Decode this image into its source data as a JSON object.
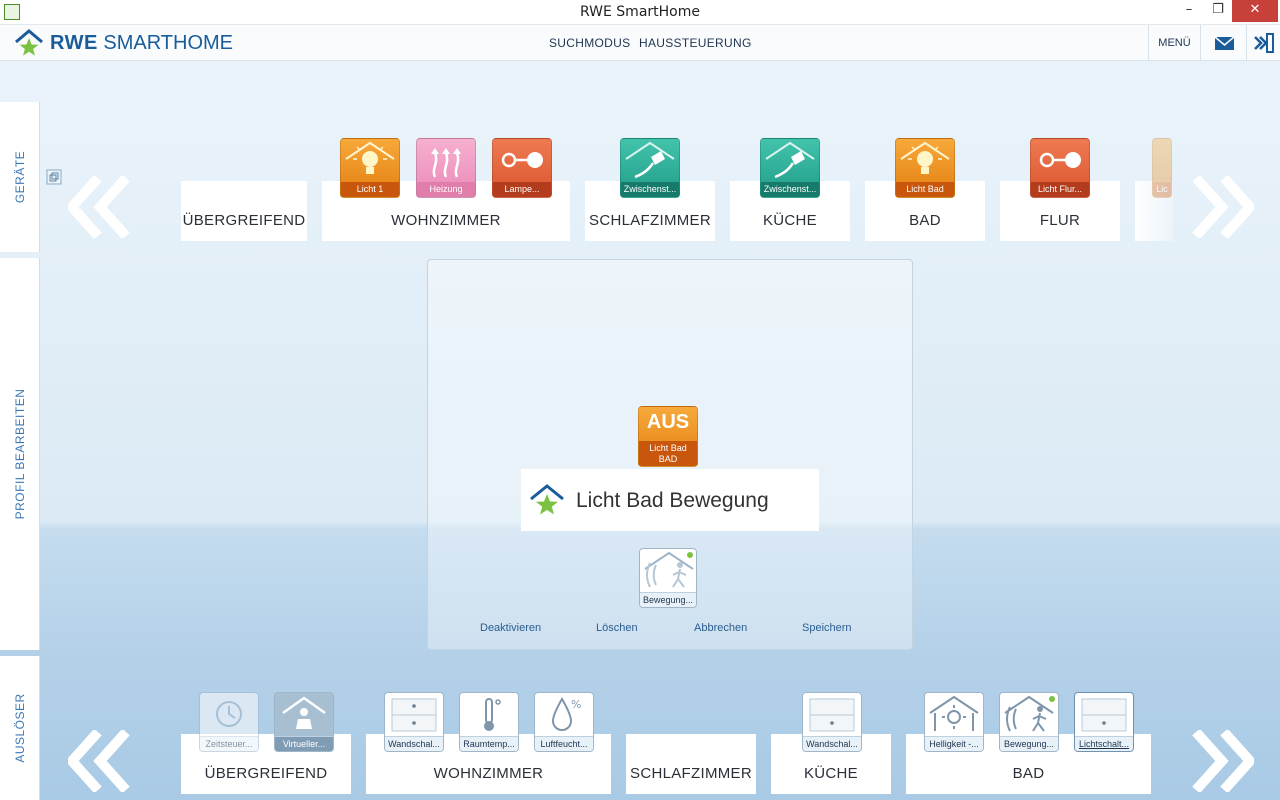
{
  "window": {
    "title": "RWE SmartHome",
    "minimize": "–",
    "restore": "❐",
    "close": "✕"
  },
  "header": {
    "logo_bold": "RWE",
    "logo_light": "SMARTHOME",
    "nav": [
      "SUCHMODUS",
      "HAUSSTEUERUNG"
    ],
    "menu_label": "MENÜ"
  },
  "sidebar": {
    "tabs": [
      "GERÄTE",
      "PROFIL BEARBEITEN",
      "AUSLÖSER"
    ]
  },
  "devices": {
    "rooms": [
      {
        "name": "ÜBERGREIFEND"
      },
      {
        "name": "WOHNZIMMER"
      },
      {
        "name": "SCHLAFZIMMER"
      },
      {
        "name": "KÜCHE"
      },
      {
        "name": "BAD"
      },
      {
        "name": "FLUR"
      }
    ],
    "tiles": [
      {
        "label": "Licht 1",
        "icon": "lightbulb-icon"
      },
      {
        "label": "Heizung",
        "icon": "heating-icon"
      },
      {
        "label": "Lampe...",
        "icon": "lamp-switch-icon"
      },
      {
        "label": "Zwischenst...",
        "icon": "plug-icon"
      },
      {
        "label": "Zwischenst...",
        "icon": "plug-icon"
      },
      {
        "label": "Licht Bad",
        "icon": "lightbulb-icon"
      },
      {
        "label": "Licht Flur...",
        "icon": "lamp-switch-icon"
      },
      {
        "label": "Lic",
        "icon": "lightbulb-icon"
      }
    ]
  },
  "editor": {
    "action_tile": {
      "state": "AUS",
      "line1": "Licht Bad",
      "line2": "BAD"
    },
    "profile_title": "Licht Bad Bewegung",
    "trigger_tile": {
      "label": "Bewegung..."
    },
    "actions": [
      "Deaktivieren",
      "Löschen",
      "Abbrechen",
      "Speichern"
    ]
  },
  "triggers": {
    "rooms": [
      {
        "name": "ÜBERGREIFEND"
      },
      {
        "name": "WOHNZIMMER"
      },
      {
        "name": "SCHLAFZIMMER"
      },
      {
        "name": "KÜCHE"
      },
      {
        "name": "BAD"
      }
    ],
    "tiles": [
      {
        "label": "Zeitsteuer...",
        "icon": "clock-icon"
      },
      {
        "label": "Virtueller...",
        "icon": "virtual-resident-icon"
      },
      {
        "label": "Wandschal...",
        "icon": "wall-switch-icon"
      },
      {
        "label": "Raumtemp...",
        "icon": "thermometer-icon"
      },
      {
        "label": "Luftfeucht...",
        "icon": "humidity-icon"
      },
      {
        "label": "Wandschal...",
        "icon": "wall-switch-icon"
      },
      {
        "label": "Helligkeit -...",
        "icon": "brightness-icon"
      },
      {
        "label": "Bewegung...",
        "icon": "motion-detector-icon"
      },
      {
        "label": "Lichtschalt...",
        "icon": "light-switch-icon"
      }
    ]
  },
  "colors": {
    "brand_blue": "#1a5c9a",
    "brand_green": "#7cc242",
    "tile_orange": "#e47f12",
    "tile_teal": "#1f9d88",
    "tile_red": "#d9552c",
    "tile_pink": "#ea8ab7",
    "link_blue": "#2a5d92"
  }
}
